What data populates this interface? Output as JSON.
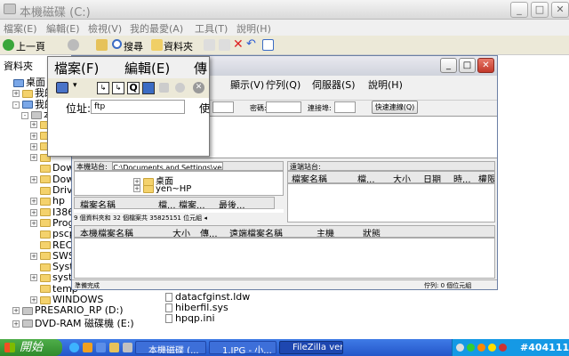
{
  "explorer": {
    "title": "本機磁碟 (C:)",
    "menu": [
      "檔案(E)",
      "編輯(E)",
      "檢視(V)",
      "我的最愛(A)",
      "工具(T)",
      "說明(H)"
    ],
    "toolbar": {
      "back": "上一頁",
      "search": "搜尋",
      "folders": "資料夾"
    },
    "folders_label": "資料夾",
    "tree": [
      {
        "label": "桌面",
        "indent": 0,
        "exp": "",
        "icon": "desktop"
      },
      {
        "label": "我的",
        "indent": 1,
        "exp": "+",
        "icon": "folder"
      },
      {
        "label": "我的",
        "indent": 1,
        "exp": "-",
        "icon": "computer"
      },
      {
        "label": "本",
        "indent": 2,
        "exp": "-",
        "icon": "drive"
      },
      {
        "label": "",
        "indent": 3,
        "exp": "+",
        "icon": "folder"
      },
      {
        "label": "",
        "indent": 3,
        "exp": "+",
        "icon": "folder"
      },
      {
        "label": "",
        "indent": 3,
        "exp": "+",
        "icon": "folder"
      },
      {
        "label": "",
        "indent": 3,
        "exp": "+",
        "icon": "folder"
      },
      {
        "label": "Down",
        "indent": 3,
        "exp": "",
        "icon": "folder"
      },
      {
        "label": "Down",
        "indent": 3,
        "exp": "+",
        "icon": "folder"
      },
      {
        "label": "Drive",
        "indent": 3,
        "exp": "",
        "icon": "folder"
      },
      {
        "label": "hp",
        "indent": 3,
        "exp": "+",
        "icon": "folder"
      },
      {
        "label": "I386",
        "indent": 3,
        "exp": "+",
        "icon": "folder"
      },
      {
        "label": "Progr",
        "indent": 3,
        "exp": "+",
        "icon": "folder"
      },
      {
        "label": "pscp",
        "indent": 3,
        "exp": "",
        "icon": "folder"
      },
      {
        "label": "RECY",
        "indent": 3,
        "exp": "",
        "icon": "folder"
      },
      {
        "label": "SWSe",
        "indent": 3,
        "exp": "+",
        "icon": "folder"
      },
      {
        "label": "Syster",
        "indent": 3,
        "exp": "",
        "icon": "folder"
      },
      {
        "label": "system",
        "indent": 3,
        "exp": "+",
        "icon": "folder"
      },
      {
        "label": "temp",
        "indent": 3,
        "exp": "",
        "icon": "folder"
      },
      {
        "label": "WINDOWS",
        "indent": 3,
        "exp": "+",
        "icon": "folder"
      },
      {
        "label": "PRESARIO_RP (D:)",
        "indent": 1,
        "exp": "+",
        "icon": "drive"
      },
      {
        "label": "DVD-RAM 磁碟機 (E:)",
        "indent": 1,
        "exp": "+",
        "icon": "drive"
      }
    ],
    "files": [
      "datacfginst.ldw",
      "hiberfil.sys",
      "hpqp.ini"
    ]
  },
  "popup": {
    "menu": [
      "檔案(F)",
      "編輯(E)",
      "傳"
    ],
    "address_label": "位址:",
    "address_value": "ftp",
    "right_label": "使"
  },
  "filezilla": {
    "menu": [
      "顯示(V)",
      "佇列(Q)",
      "伺服器(S)",
      "說明(H)"
    ],
    "conn": {
      "password_label": "密碼:",
      "port_label": "連接埠:",
      "quickconnect": "快速連線(Q)"
    },
    "local_site_label": "本機站台:",
    "local_site_value": "C:\\Documents and Settings\\yen-HP\\桌面\\",
    "remote_site_label": "遠端站台:",
    "local_tree": [
      "桌面",
      "yen~HP"
    ],
    "local_cols": [
      "檔案名稱",
      "檔...",
      "檔案...",
      "最後..."
    ],
    "remote_cols": [
      "檔案名稱",
      "檔...",
      "大小",
      "日期",
      "時...",
      "權限"
    ],
    "local_status": "9 個資料夾和 32 個檔案共 35825151 位元組 ◂",
    "queue_cols": [
      "本機檔案名稱",
      "大小",
      "傳...",
      "遠端檔案名稱",
      "主機",
      "狀態"
    ],
    "status_left": "準備完成",
    "status_right": "佇列: 0 個位元組"
  },
  "taskbar": {
    "start": "開始",
    "tasks": [
      "本機磁碟 (...",
      "1.JPG - 小...",
      "FileZilla vers..."
    ],
    "watermark": "#404111"
  }
}
